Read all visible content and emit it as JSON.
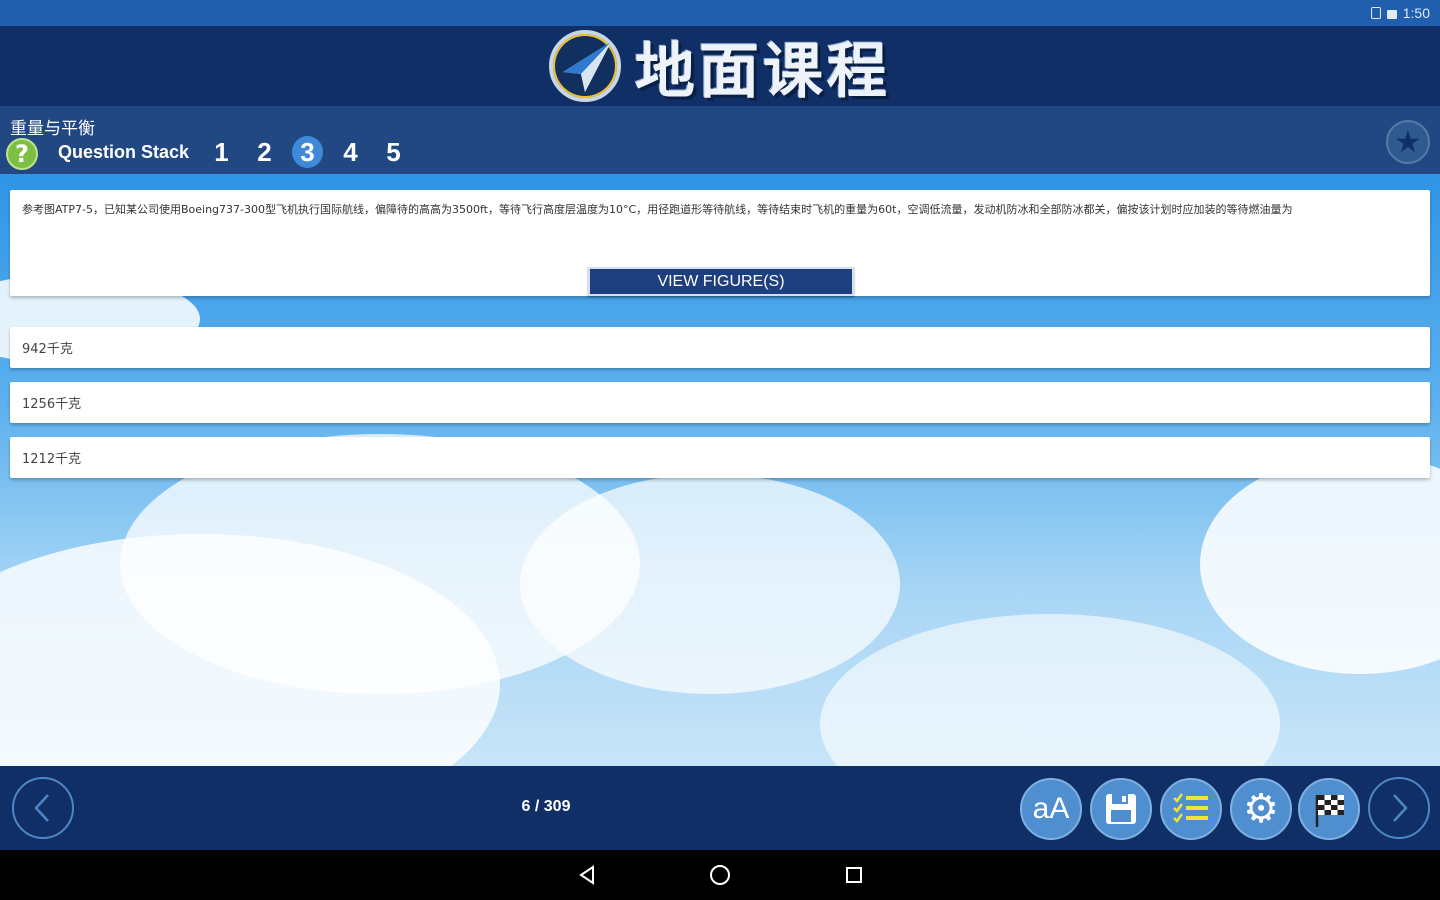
{
  "status_bar": {
    "time": "1:50"
  },
  "header": {
    "title": "地面课程"
  },
  "subheader": {
    "category": "重量与平衡",
    "help_label": "?",
    "stack_label": "Question Stack",
    "question_numbers": [
      "1",
      "2",
      "3",
      "4",
      "5"
    ],
    "active_question": "3"
  },
  "question": {
    "text": "参考图ATP7-5，已知某公司使用Boeing737-300型飞机执行国际航线，偏障待的高高为3500ft，等待飞行高度层温度为10°C，用径跑道形等待航线，等待结束时飞机的重量为60t，空调低流量，发动机防冰和全部防冰都关，偏按该计划时应加装的等待燃油量为",
    "view_figures_label": "VIEW FIGURE(S)"
  },
  "answers": [
    {
      "text": "942千克"
    },
    {
      "text": "1256千克"
    },
    {
      "text": "1212千克"
    }
  ],
  "toolbar": {
    "progress": "6 / 309",
    "font_size_label": "aA"
  },
  "colors": {
    "header_bg": "#0f2f66",
    "subheader_bg": "#214883",
    "status_bar_bg": "#1f5fae",
    "tool_button": "#4f8fcf",
    "help_green": "#7cc043",
    "active_number": "#3f8ad8"
  },
  "icons": {
    "logo": "paper-plane-compass-icon",
    "help": "question-mark-icon",
    "favorite": "star-icon",
    "prev": "chevron-left-icon",
    "next": "chevron-right-icon",
    "font_size": "text-size-icon",
    "save": "floppy-disk-icon",
    "list": "checklist-icon",
    "settings": "gear-icon",
    "finish": "checkered-flag-icon"
  }
}
